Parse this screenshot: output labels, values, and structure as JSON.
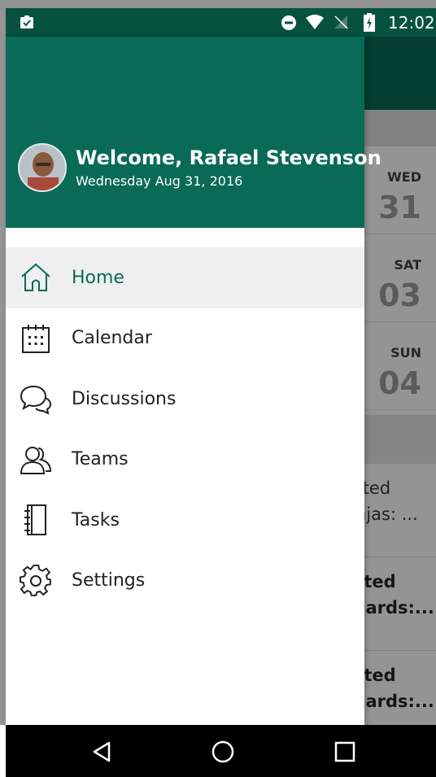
{
  "status_bar": {
    "time": "12:02"
  },
  "drawer": {
    "header": {
      "welcome": "Welcome, Rafael Stevenson",
      "date": "Wednesday Aug 31, 2016",
      "accent_color": "#086a57"
    },
    "items": [
      {
        "label": "Home",
        "icon": "home-icon",
        "active": true
      },
      {
        "label": "Calendar",
        "icon": "calendar-icon",
        "active": false
      },
      {
        "label": "Discussions",
        "icon": "discussions-icon",
        "active": false
      },
      {
        "label": "Teams",
        "icon": "teams-icon",
        "active": false
      },
      {
        "label": "Tasks",
        "icon": "tasks-icon",
        "active": false
      },
      {
        "label": "Settings",
        "icon": "gear-icon",
        "active": false
      }
    ]
  },
  "background": {
    "days": [
      {
        "dow": "WED",
        "num": "31"
      },
      {
        "dow": "SAT",
        "num": "03"
      },
      {
        "dow": "SUN",
        "num": "04"
      }
    ],
    "cards": [
      {
        "line1": "rted",
        "line2": "njas: ...",
        "bold": false
      },
      {
        "line1": "rted",
        "line2": "cards:...",
        "bold": true
      },
      {
        "line1": "rted",
        "line2": "cards:...",
        "bold": true
      }
    ]
  },
  "nav_bar": {
    "buttons": [
      "back-icon",
      "home-circle-icon",
      "recents-icon"
    ]
  }
}
